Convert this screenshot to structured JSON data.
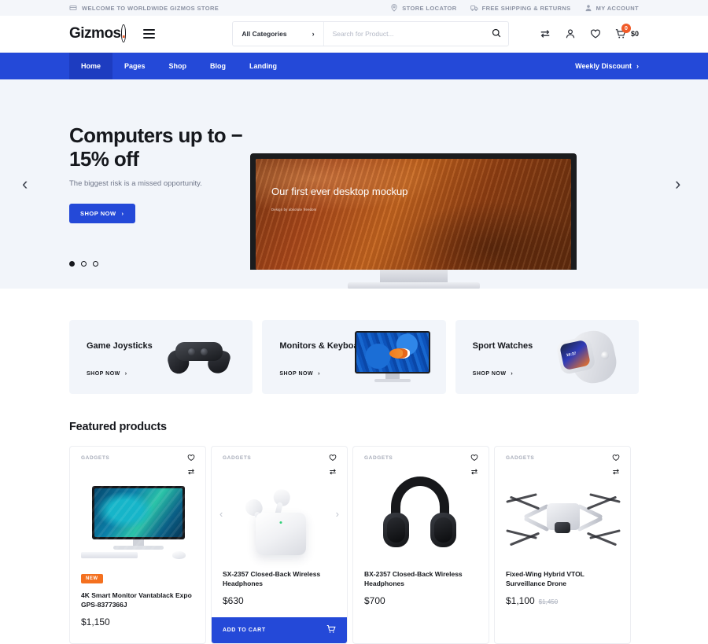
{
  "topbar": {
    "welcome": "WELCOME TO WORLDWIDE GIZMOS STORE",
    "links": [
      {
        "label": "STORE LOCATOR",
        "icon": "location-pin-icon"
      },
      {
        "label": "FREE SHIPPING & RETURNS",
        "icon": "truck-icon"
      },
      {
        "label": "MY ACCOUNT",
        "icon": "user-icon"
      }
    ]
  },
  "header": {
    "logo": "Gizmos",
    "logo_dot": ".",
    "menu_icon": "hamburger-menu-icon",
    "search": {
      "category_label": "All Categories",
      "category_chevron": "chevron-right-icon",
      "placeholder": "Search for Product...",
      "value": "",
      "search_icon": "search-icon"
    },
    "icons": [
      {
        "name": "compare-icon"
      },
      {
        "name": "account-icon"
      },
      {
        "name": "wishlist-heart-icon"
      }
    ],
    "cart": {
      "icon": "shopping-cart-icon",
      "count": "0",
      "total": "$0"
    }
  },
  "nav": {
    "items": [
      {
        "label": "Home",
        "active": true
      },
      {
        "label": "Pages",
        "active": false
      },
      {
        "label": "Shop",
        "active": false
      },
      {
        "label": "Blog",
        "active": false
      },
      {
        "label": "Landing",
        "active": false
      }
    ],
    "right_label": "Weekly Discount",
    "right_chevron": "chevron-right-icon"
  },
  "hero": {
    "title": "Computers up to − 15% off",
    "subtitle": "The biggest risk is a missed opportunity.",
    "cta": "SHOP NOW",
    "cta_chevron": "chevron-right-icon",
    "prev_arrow": "chevron-left-icon",
    "next_arrow": "chevron-right-icon",
    "dots": [
      true,
      false,
      false
    ],
    "mockup": {
      "screen_title": "Our first ever desktop mockup",
      "screen_caption": "Design by absolute freedom"
    }
  },
  "categories": {
    "cards": [
      {
        "title": "Game Joysticks",
        "cta": "SHOP NOW",
        "art": "gamepad"
      },
      {
        "title": "Monitors & Keyboards",
        "cta": "SHOP NOW",
        "art": "monitor"
      },
      {
        "title": "Sport Watches",
        "cta": "SHOP NOW",
        "art": "watch"
      }
    ]
  },
  "featured": {
    "title": "Featured products",
    "products": [
      {
        "brand": "GADGETS",
        "badge": "NEW",
        "name": "4K Smart Monitor Vantablack Expo GPS-8377366J",
        "price": "$1,150",
        "old_price": "",
        "has_add_to_cart": false,
        "has_carousel_arrows": false,
        "wishlist_icon": "wishlist-heart-icon",
        "compare_icon": "compare-icon"
      },
      {
        "brand": "GADGETS",
        "badge": "",
        "name": "SX-2357 Closed-Back Wireless Headphones",
        "price": "$630",
        "old_price": "",
        "has_add_to_cart": true,
        "add_to_cart_label": "ADD TO CART",
        "add_to_cart_icon": "shopping-cart-icon",
        "has_carousel_arrows": true,
        "prev_arrow": "chevron-left-icon",
        "next_arrow": "chevron-right-icon",
        "wishlist_icon": "wishlist-heart-icon",
        "compare_icon": "compare-icon"
      },
      {
        "brand": "GADGETS",
        "badge": "",
        "name": "BX-2357 Closed-Back Wireless Headphones",
        "price": "$700",
        "old_price": "",
        "has_add_to_cart": false,
        "has_carousel_arrows": false,
        "wishlist_icon": "wishlist-heart-icon",
        "compare_icon": "compare-icon"
      },
      {
        "brand": "GADGETS",
        "badge": "",
        "name": "Fixed-Wing Hybrid VTOL Surveillance Drone",
        "price": "$1,100",
        "old_price": "$1,450",
        "has_add_to_cart": false,
        "has_carousel_arrows": false,
        "wishlist_icon": "wishlist-heart-icon",
        "compare_icon": "compare-icon"
      }
    ]
  },
  "colors": {
    "brand_blue": "#2449d8",
    "brand_blue_dark": "#1d3cc0",
    "accent_orange": "#f05a28",
    "badge_orange": "#f4701f",
    "light_bg": "#f2f5fa",
    "text_dark": "#16181d",
    "text_muted": "#70778a"
  }
}
